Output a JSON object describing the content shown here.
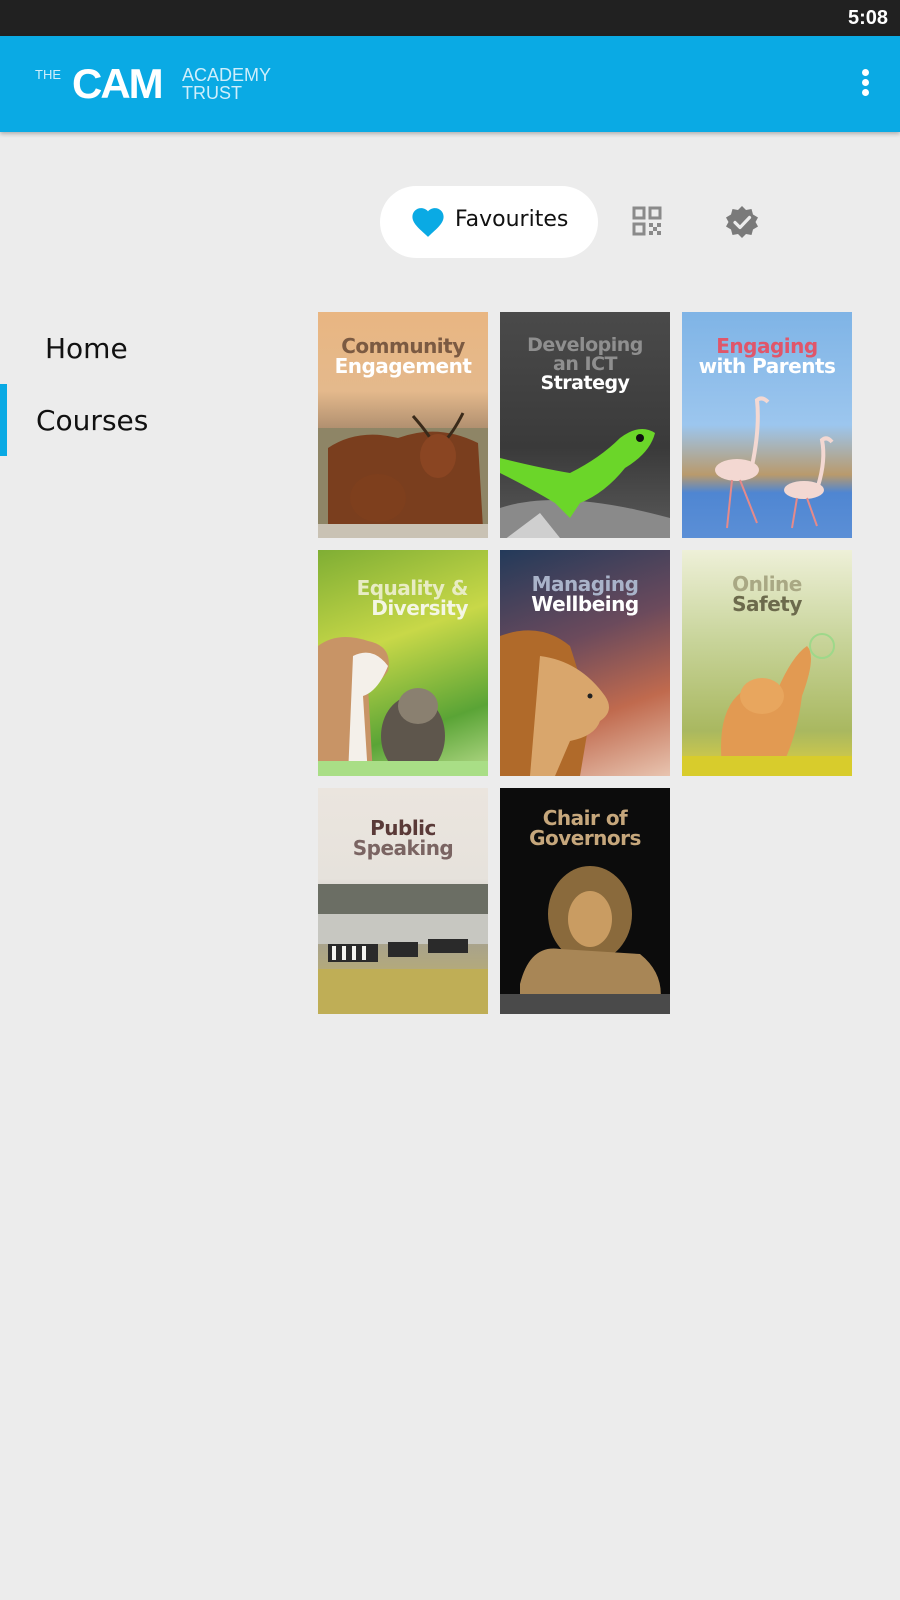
{
  "status_bar": {
    "time": "5:08"
  },
  "app_bar": {
    "logo": {
      "the": "THE",
      "cam": "CAM",
      "academy_line1": "ACADEMY",
      "academy_line2": "TRUST"
    },
    "menu_icon": "more-vert-icon",
    "brand_color": "#0aaae4"
  },
  "toolbar": {
    "favourites_label": "Favourites",
    "favourites_icon": "heart-icon",
    "qr_icon": "qr-code-icon",
    "verified_icon": "verified-badge-icon"
  },
  "sidebar": {
    "items": [
      {
        "label": "Home",
        "active": false
      },
      {
        "label": "Courses",
        "active": true
      }
    ]
  },
  "courses": [
    {
      "line1": "Community",
      "line2": "Engagement",
      "line3": "",
      "image": "highland-cattle"
    },
    {
      "line1": "Developing",
      "line2": "an ICT",
      "line3": "Strategy",
      "image": "green-lizard"
    },
    {
      "line1": "Engaging",
      "line2": "with Parents",
      "line3": "",
      "image": "flamingos"
    },
    {
      "line1": "Equality &",
      "line2": "Diversity",
      "line3": "",
      "image": "puppy-and-kitten"
    },
    {
      "line1": "Managing",
      "line2": "Wellbeing",
      "line3": "",
      "image": "lion-profile"
    },
    {
      "line1": "Online",
      "line2": "Safety",
      "line3": "",
      "image": "kitten-with-bubbles"
    },
    {
      "line1": "Public",
      "line2": "Speaking",
      "line3": "",
      "image": "zebras"
    },
    {
      "line1": "Chair of",
      "line2": "Governors",
      "line3": "",
      "image": "resting-lion"
    }
  ]
}
